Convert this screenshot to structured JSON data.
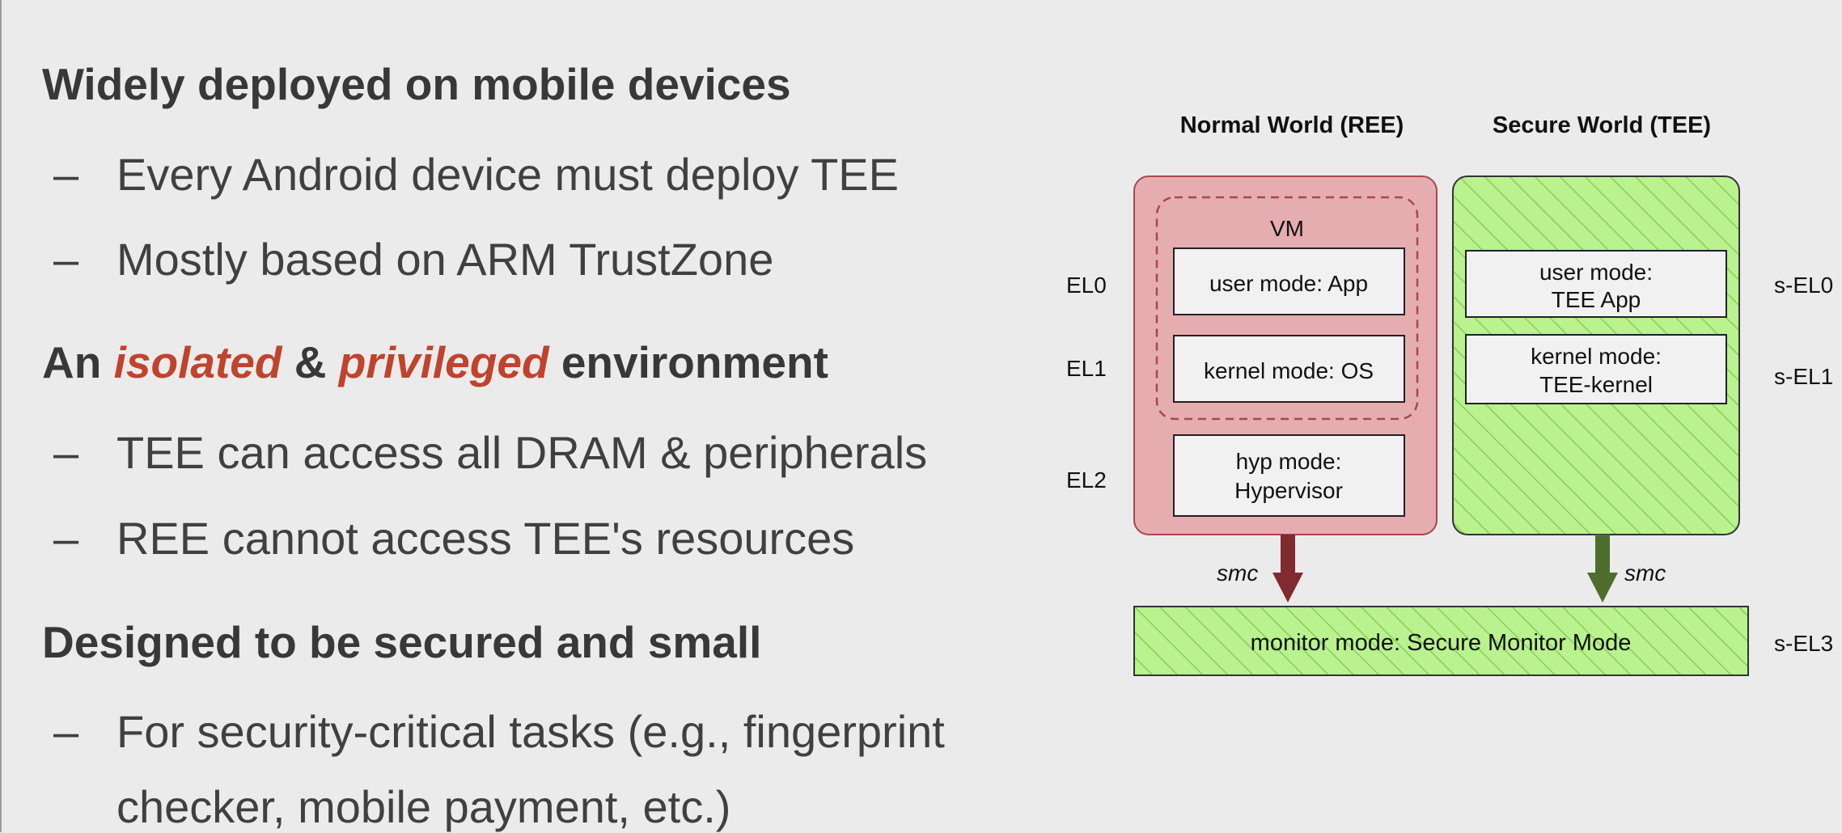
{
  "slide": {
    "sections": [
      {
        "heading": "Widely deployed on mobile devices",
        "bullets": [
          "Every Android device must deploy TEE",
          "Mostly based on ARM TrustZone"
        ]
      },
      {
        "heading_parts": [
          "An ",
          "isolated",
          " & ",
          "privileged",
          " environment"
        ],
        "bullets": [
          "TEE can access all DRAM & peripherals",
          "REE cannot access TEE's resources"
        ]
      },
      {
        "heading": "Designed to be secured and small",
        "bullets": [
          "For security-critical tasks (e.g., fingerprint",
          "checker, mobile payment, etc.)"
        ]
      }
    ],
    "accent_color": "#c0432e"
  },
  "diagram": {
    "normal_world_title": "Normal World (REE)",
    "secure_world_title": "Secure World (TEE)",
    "vm_label": "VM",
    "levels_left": [
      "EL0",
      "EL1",
      "EL2"
    ],
    "levels_right": [
      "s-EL0",
      "s-EL1",
      "s-EL3"
    ],
    "normal_boxes": [
      "user mode: App",
      "kernel mode: OS",
      [
        "hyp mode:",
        "Hypervisor"
      ]
    ],
    "secure_boxes": [
      [
        "user mode:",
        "TEE App"
      ],
      [
        "kernel mode:",
        "TEE-kernel"
      ]
    ],
    "monitor_label": "monitor mode: Secure Monitor Mode",
    "smc_label": "smc",
    "colors": {
      "normal_fill": "#e6adb0",
      "normal_stroke": "#a9474c",
      "secure_fill": "#b9f28e",
      "hatch": "#8dcc5d",
      "arrow_normal": "#7f2b2f",
      "arrow_secure": "#4f6d2c"
    }
  }
}
